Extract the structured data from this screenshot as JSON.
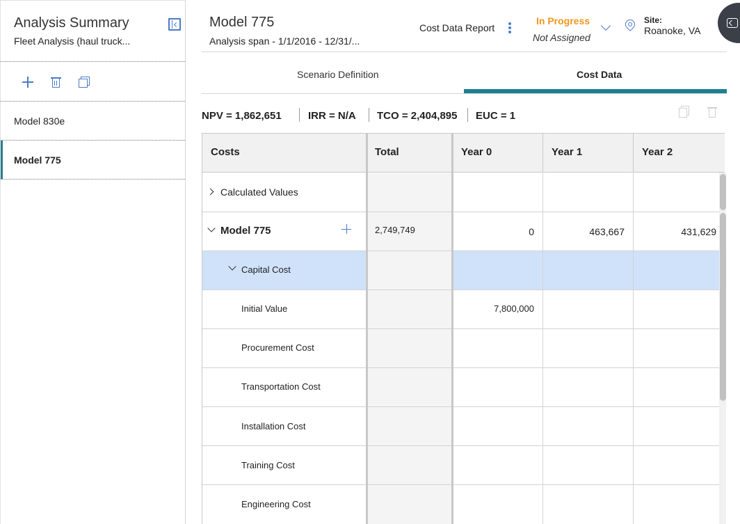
{
  "left_panel": {
    "title": "Analysis Summary",
    "subtitle": "Fleet Analysis (haul truck...",
    "items": [
      {
        "label": "Model 830e",
        "active": false
      },
      {
        "label": "Model 775",
        "active": true
      }
    ]
  },
  "header": {
    "title": "Model 775",
    "subtitle": "Analysis span - 1/1/2016 - 12/31/...",
    "report_label": "Cost Data Report",
    "status": "In Progress",
    "assigned": "Not Assigned",
    "site_label": "Site:",
    "site_value": "Roanoke, VA"
  },
  "tabs": [
    {
      "label": "Scenario Definition",
      "active": false
    },
    {
      "label": "Cost Data",
      "active": true
    }
  ],
  "metrics": {
    "npv": "NPV = 1,862,651",
    "irr": "IRR = N/A",
    "tco": "TCO = 2,404,895",
    "euc": "EUC = 1"
  },
  "grid": {
    "columns": [
      "Costs",
      "Total",
      "Year 0",
      "Year 1",
      "Year 2"
    ],
    "rows": [
      {
        "label": "Calculated Values",
        "total": "",
        "year0": "",
        "year1": "",
        "year2": ""
      },
      {
        "label": "Model 775",
        "total": "2,749,749",
        "year0": "0",
        "year1": "463,667",
        "year2": "431,629"
      },
      {
        "label": "Capital Cost",
        "total": "",
        "year0": "",
        "year1": "",
        "year2": ""
      },
      {
        "label": "Initial Value",
        "total": "",
        "year0": "7,800,000",
        "year1": "",
        "year2": ""
      },
      {
        "label": "Procurement Cost",
        "total": "",
        "year0": "",
        "year1": "",
        "year2": ""
      },
      {
        "label": "Transportation Cost",
        "total": "",
        "year0": "",
        "year1": "",
        "year2": ""
      },
      {
        "label": "Installation Cost",
        "total": "",
        "year0": "",
        "year1": "",
        "year2": ""
      },
      {
        "label": "Training Cost",
        "total": "",
        "year0": "",
        "year1": "",
        "year2": ""
      },
      {
        "label": "Engineering Cost",
        "total": "",
        "year0": "",
        "year1": "",
        "year2": ""
      }
    ]
  },
  "colors": {
    "accent": "#4a7bc8",
    "tab_underline": "#1f7f91",
    "status": "#f0961e",
    "selected_row": "#cfe2fa"
  }
}
